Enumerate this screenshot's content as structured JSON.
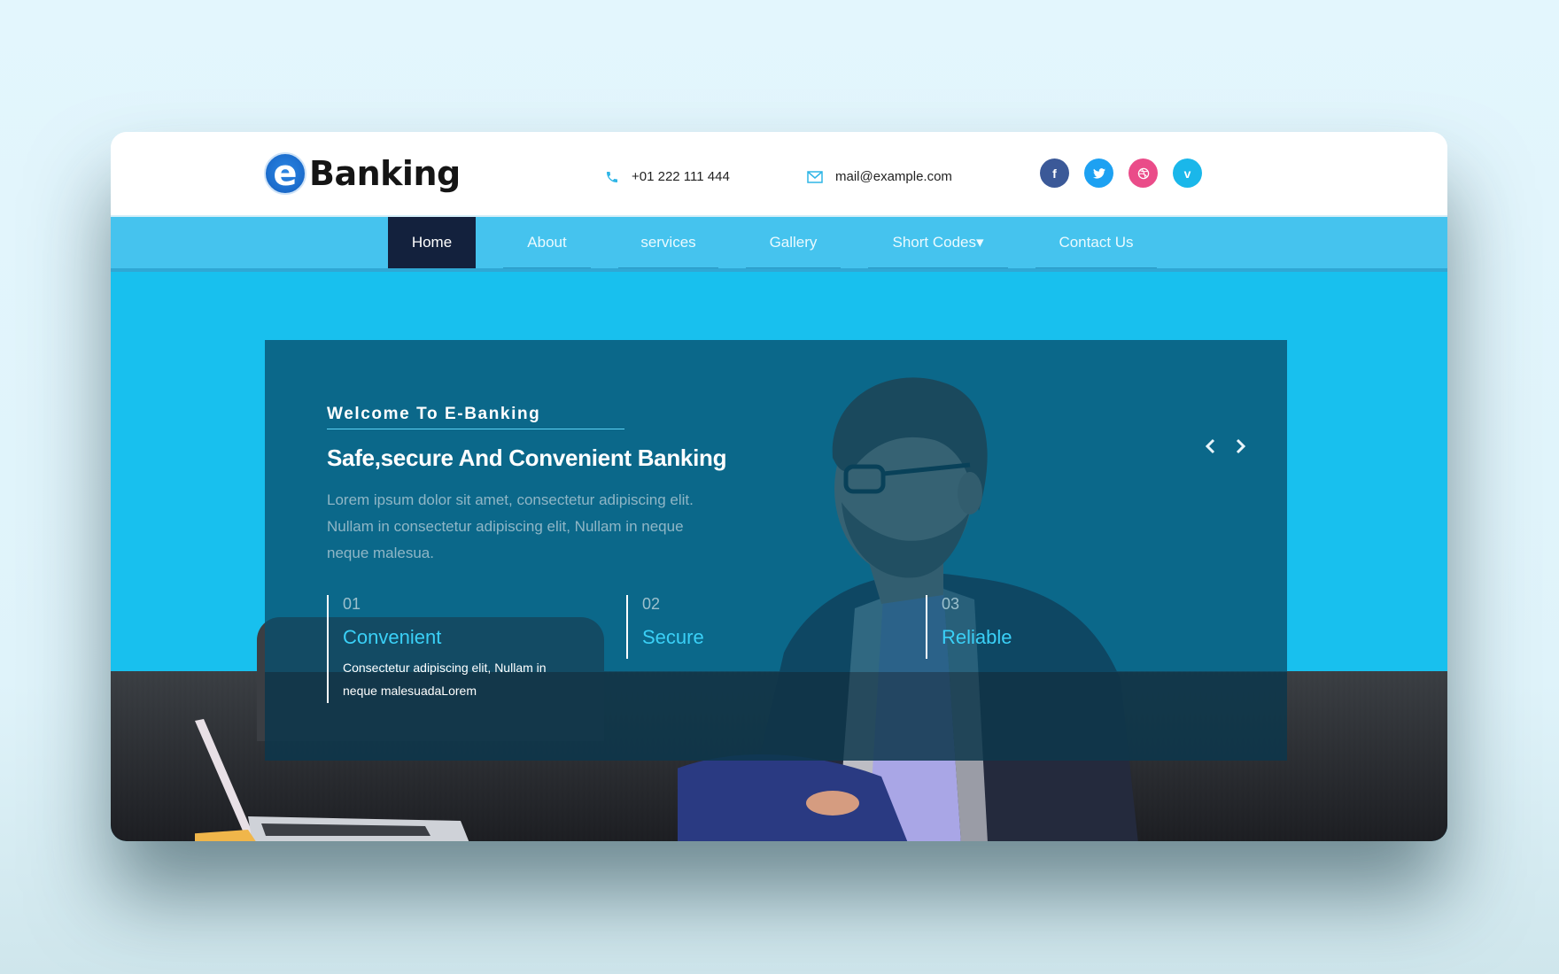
{
  "brand": {
    "logo_letter": "e",
    "logo_text": "Banking"
  },
  "contact": {
    "phone": "+01 222 111 444",
    "email": "mail@example.com"
  },
  "socials": [
    {
      "name": "facebook",
      "glyph": "f",
      "color": "#3b5998"
    },
    {
      "name": "twitter",
      "glyph": "t",
      "color": "#1da1f2"
    },
    {
      "name": "dribbble",
      "glyph": "⊛",
      "color": "#ea4c89"
    },
    {
      "name": "vimeo",
      "glyph": "v",
      "color": "#1ab7ea"
    }
  ],
  "nav": {
    "items": [
      {
        "label": "Home",
        "active": true
      },
      {
        "label": "About"
      },
      {
        "label": "services"
      },
      {
        "label": "Gallery"
      },
      {
        "label": "Short Codes▾"
      },
      {
        "label": "Contact Us"
      }
    ]
  },
  "hero": {
    "welcome": "Welcome To E-Banking",
    "headline": "Safe,secure And Convenient Banking",
    "intro": "Lorem ipsum dolor sit amet, consectetur adipiscing elit. Nullam in consectetur adipiscing elit, Nullam in neque neque malesua.",
    "features": [
      {
        "num": "01",
        "title": "Convenient",
        "desc": "Consectetur adipiscing elit, Nullam in neque malesuadaLorem"
      },
      {
        "num": "02",
        "title": "Secure",
        "desc": ""
      },
      {
        "num": "03",
        "title": "Reliable",
        "desc": ""
      }
    ]
  },
  "colors": {
    "accent": "#18c0ee",
    "nav": "#45c3ee",
    "active": "#13213d",
    "feature_title": "#3ad0f7"
  }
}
